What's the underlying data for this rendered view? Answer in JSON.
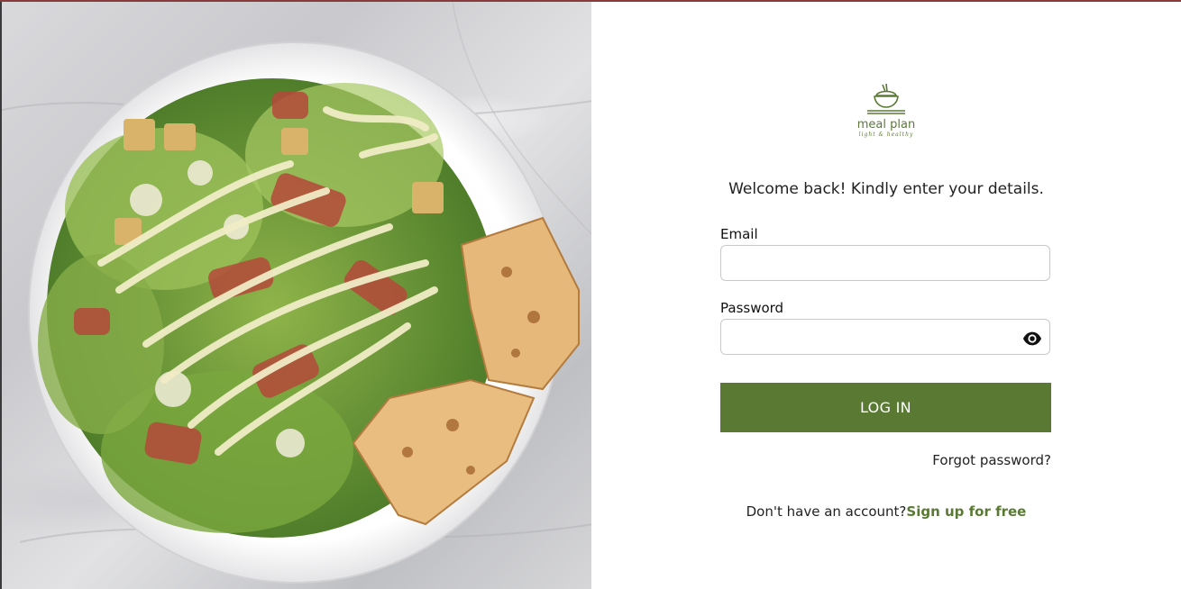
{
  "hero_image": {
    "description_icon": "salad-photo"
  },
  "brand": {
    "name": "meal plan",
    "tagline": "light & healthy",
    "color": "#5a7a34",
    "icon": "rice-bowl-icon"
  },
  "form": {
    "welcome": "Welcome back! Kindly enter your details.",
    "email_label": "Email",
    "email_value": "",
    "password_label": "Password",
    "password_value": "",
    "login_label": "LOG IN",
    "forgot_label": "Forgot password?",
    "signup_prompt": "Don't have an account?",
    "signup_link": "Sign up for free"
  }
}
